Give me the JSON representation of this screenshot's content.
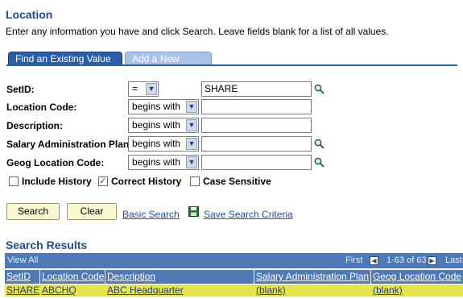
{
  "page": {
    "title": "Location",
    "instructions": "Enter any information you have and click Search. Leave fields blank for a list of all values."
  },
  "tabs": [
    {
      "label": "Find an Existing Value"
    },
    {
      "label": "Add a New Value"
    }
  ],
  "fields": {
    "setid": {
      "label": "SetID:",
      "operator": "=",
      "value": "SHARE"
    },
    "location_code": {
      "label": "Location Code:",
      "operator": "begins with",
      "value": ""
    },
    "description": {
      "label": "Description:",
      "operator": "begins with",
      "value": ""
    },
    "salary_plan": {
      "label": "Salary Administration Plan:",
      "operator": "begins with",
      "value": ""
    },
    "geog_location": {
      "label": "Geog Location Code:",
      "operator": "begins with",
      "value": ""
    }
  },
  "checkboxes": {
    "include_history": {
      "label": "Include History",
      "checked": false
    },
    "correct_history": {
      "label": "Correct History",
      "checked": true
    },
    "case_sensitive": {
      "label": "Case Sensitive",
      "checked": false
    }
  },
  "buttons": {
    "search": "Search",
    "clear": "Clear",
    "basic_search": "Basic Search",
    "save_criteria": "Save Search Criteria"
  },
  "results": {
    "title": "Search Results",
    "view_all": "View All",
    "first": "First",
    "range": "1-63 of 63",
    "last": "Last",
    "columns": [
      "SetID",
      "Location Code",
      "Description",
      "Salary Administration Plan",
      "Geog Location Code"
    ],
    "rows": [
      [
        "SHARE",
        "ABCHQ",
        "ABC Headquarter",
        "(blank)",
        "(blank)"
      ]
    ]
  },
  "colors": {
    "accent": "#224b8f",
    "grid_header": "#4e79b5",
    "highlight_row": "#e5e549",
    "button_bg": "#fafad2"
  },
  "icons": {
    "lookup": "magnifier-icon",
    "save": "floppy-disk-icon",
    "dropdown": "chevron-down-icon",
    "prev": "arrow-left-icon",
    "next": "arrow-right-icon"
  }
}
